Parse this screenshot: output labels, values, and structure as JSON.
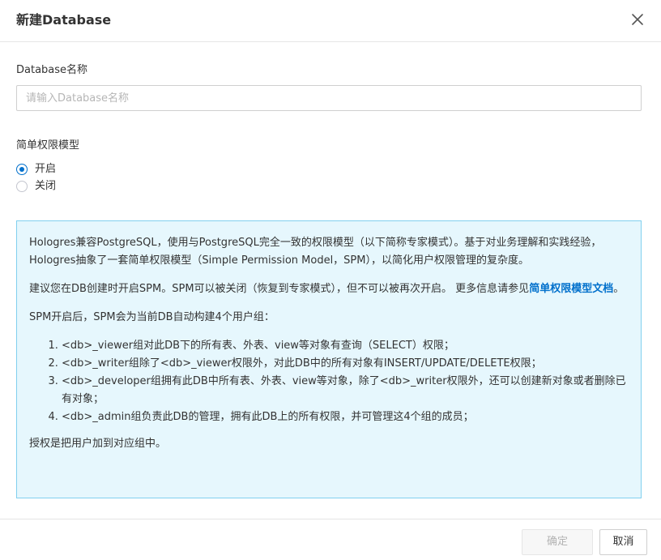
{
  "dialog": {
    "title": "新建Database",
    "close_icon": "close-icon"
  },
  "form": {
    "name_label": "Database名称",
    "name_value": "",
    "name_placeholder": "请输入Database名称",
    "spm_label": "简单权限模型",
    "spm_options": [
      {
        "label": "开启",
        "checked": true
      },
      {
        "label": "关闭",
        "checked": false
      }
    ]
  },
  "notice": {
    "paragraph1": "Hologres兼容PostgreSQL，使用与PostgreSQL完全一致的权限模型（以下简称专家模式）。基于对业务理解和实践经验，Hologres抽象了一套简单权限模型（Simple Permission Model，SPM），以简化用户权限管理的复杂度。",
    "paragraph2_prefix": "建议您在DB创建时开启SPM。SPM可以被关闭（恢复到专家模式），但不可以被再次开启。 更多信息请参见",
    "paragraph2_link": "简单权限模型文档",
    "paragraph2_suffix": "。",
    "paragraph3": "SPM开启后，SPM会为当前DB自动构建4个用户组：",
    "list": [
      "<db>_viewer组对此DB下的所有表、外表、view等对象有查询（SELECT）权限；",
      "<db>_writer组除了<db>_viewer权限外，对此DB中的所有对象有INSERT/UPDATE/DELETE权限；",
      "<db>_developer组拥有此DB中所有表、外表、view等对象，除了<db>_writer权限外，还可以创建新对象或者删除已有对象；",
      "<db>_admin组负责此DB的管理，拥有此DB上的所有权限，并可管理这4个组的成员；"
    ],
    "paragraph4": "授权是把用户加到对应组中。"
  },
  "footer": {
    "confirm_label": "确定",
    "confirm_disabled": true,
    "cancel_label": "取消"
  },
  "colors": {
    "accent": "#0070cc",
    "notice_bg": "#e6f7fd",
    "notice_border": "#81d0ef"
  }
}
